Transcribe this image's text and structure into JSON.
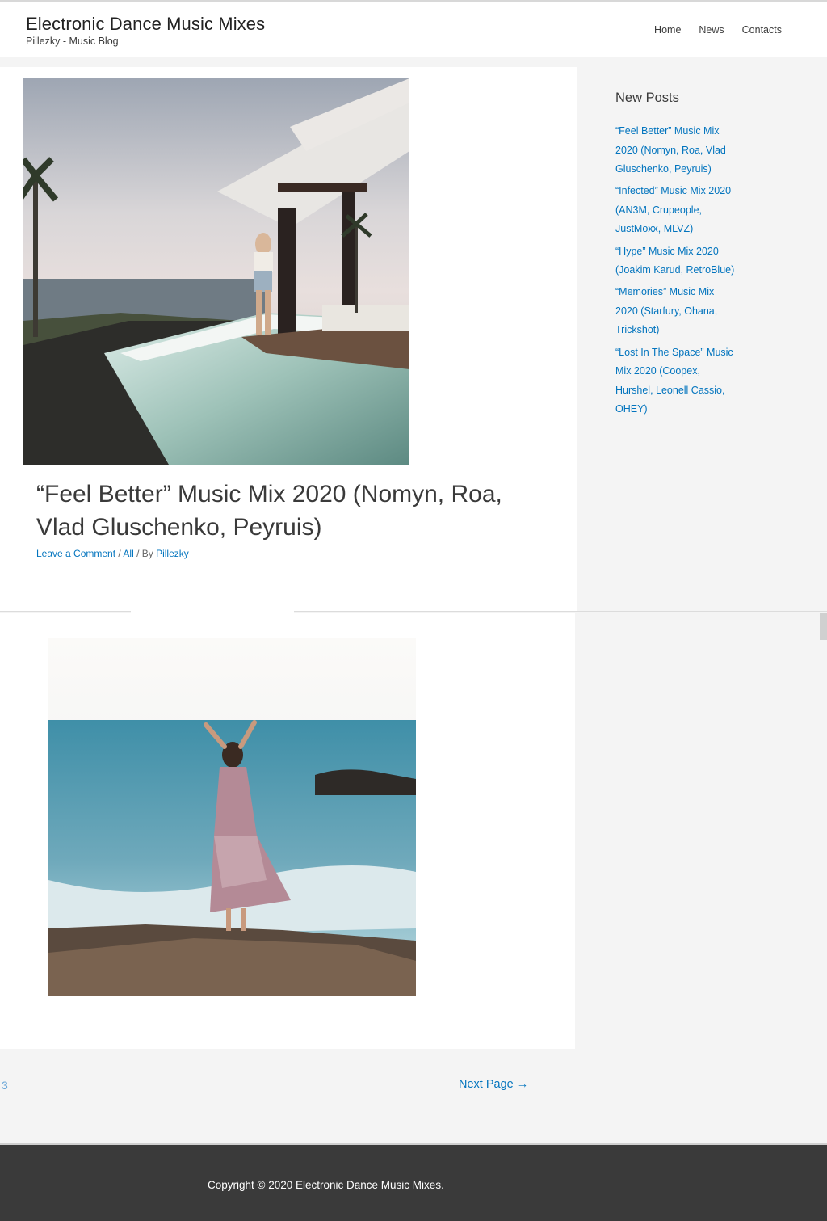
{
  "site": {
    "title": "Electronic Dance Music Mixes",
    "tagline": "Pillezky - Music Blog"
  },
  "nav": {
    "items": [
      "Home",
      "News",
      "Contacts"
    ]
  },
  "posts": [
    {
      "title": "“Feel Better” Music Mix 2020 (Nomyn, Roa, Vlad Gluschenko, Peyruis)",
      "meta": {
        "comment_link": "Leave a Comment",
        "sep1": " / ",
        "category": "All",
        "sep2": " / By ",
        "author": "Pillezky"
      },
      "image": "woman-by-infinity-pool-photo"
    },
    {
      "image": "woman-dancing-by-sea-photo"
    }
  ],
  "sidebar": {
    "heading": "New Posts",
    "links": [
      "“Feel Better” Music Mix 2020 (Nomyn, Roa, Vlad Gluschenko, Peyruis)",
      "“Infected” Music Mix 2020 (AN3M, Crupeople, JustMoxx, MLVZ)",
      "“Hype” Music Mix 2020 (Joakim Karud, RetroBlue)",
      "“Memories” Music Mix 2020 (Starfury, Ohana, Trickshot)",
      "“Lost In The Space” Music Mix 2020 (Coopex, Hurshel, Leonell Cassio, OHEY)"
    ]
  },
  "pagination": {
    "prev_page_number": "3",
    "next_label": "Next Page →"
  },
  "footer": {
    "copyright": "Copyright © 2020 Electronic Dance Music Mixes."
  },
  "colors": {
    "link": "#0274be",
    "page_bg": "#f4f4f4",
    "footer_bg": "#3a3a3a"
  }
}
